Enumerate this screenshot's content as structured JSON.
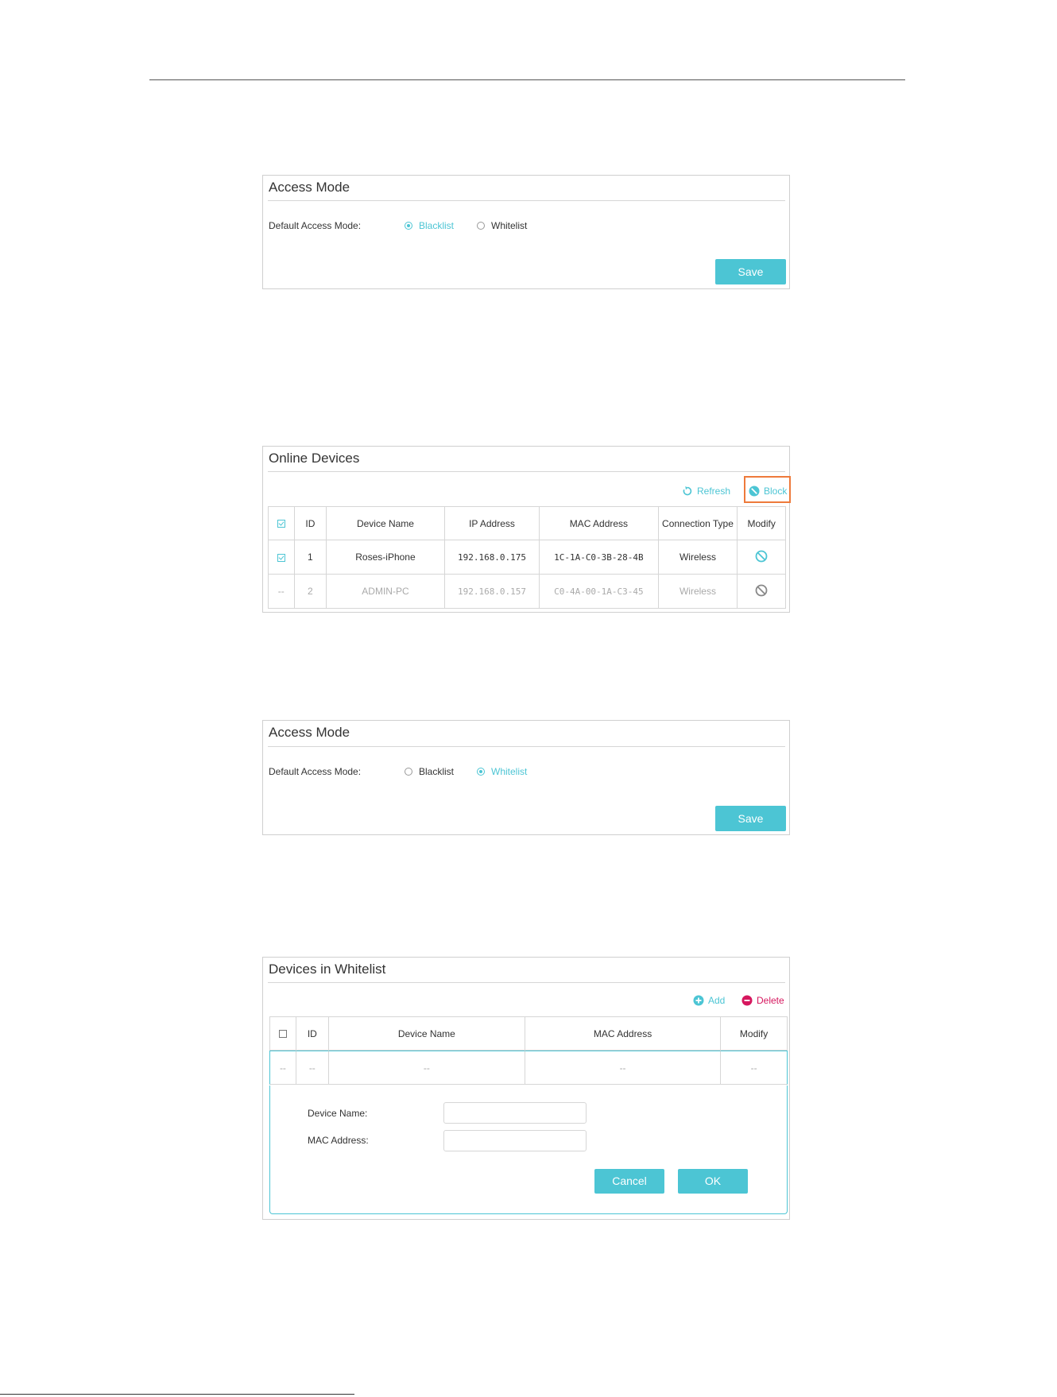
{
  "panel1": {
    "title": "Access Mode",
    "mode_label": "Default Access Mode:",
    "options": [
      {
        "label": "Blacklist",
        "selected": true
      },
      {
        "label": "Whitelist",
        "selected": false
      }
    ],
    "save_label": "Save"
  },
  "online": {
    "title": "Online Devices",
    "refresh_label": "Refresh",
    "block_label": "Block",
    "columns": [
      "ID",
      "Device Name",
      "IP Address",
      "MAC Address",
      "Connection Type",
      "Modify"
    ],
    "rows": [
      {
        "check": "checked",
        "id": "1",
        "name": "Roses-iPhone",
        "ip": "192.168.0.175",
        "mac": "1C-1A-C0-3B-28-4B",
        "type": "Wireless"
      },
      {
        "check": "--",
        "id": "2",
        "name": "ADMIN-PC",
        "ip": "192.168.0.157",
        "mac": "C0-4A-00-1A-C3-45",
        "type": "Wireless"
      }
    ]
  },
  "panel3": {
    "title": "Access Mode",
    "mode_label": "Default Access Mode:",
    "options": [
      {
        "label": "Blacklist",
        "selected": false
      },
      {
        "label": "Whitelist",
        "selected": true
      }
    ],
    "save_label": "Save"
  },
  "whitelist": {
    "title": "Devices in Whitelist",
    "add_label": "Add",
    "delete_label": "Delete",
    "columns": [
      "ID",
      "Device Name",
      "MAC Address",
      "Modify"
    ],
    "empty_row": [
      "--",
      "--",
      "--",
      "--",
      "--"
    ],
    "device_name_label": "Device Name:",
    "mac_label": "MAC Address:",
    "cancel_label": "Cancel",
    "ok_label": "OK"
  },
  "colors": {
    "accent": "#4cc5d4",
    "delete": "#d6175e",
    "highlight": "#ee7a3b"
  }
}
